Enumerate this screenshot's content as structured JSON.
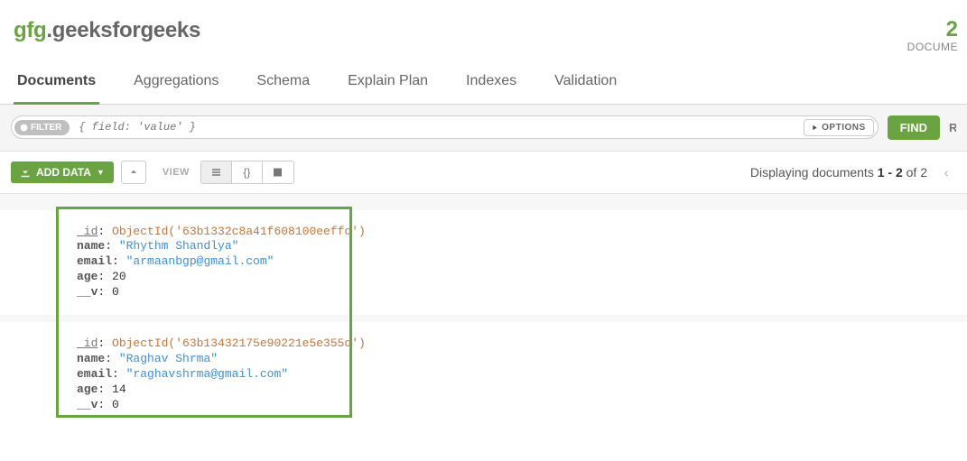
{
  "namespace": {
    "db": "gfg",
    "dot": ".",
    "collection": "geeksforgeeks"
  },
  "stats": {
    "count": "2",
    "label": "DOCUME"
  },
  "tabs": [
    "Documents",
    "Aggregations",
    "Schema",
    "Explain Plan",
    "Indexes",
    "Validation"
  ],
  "activeTab": 0,
  "query": {
    "filterChip": "FILTER",
    "placeholder": "{ field: 'value' }",
    "optionsLabel": "OPTIONS",
    "findLabel": "FIND",
    "resetStub": "R"
  },
  "toolbar": {
    "addData": "ADD DATA",
    "viewLabel": "VIEW",
    "jsonViewGlyph": "{}"
  },
  "pager": {
    "prefix": "Displaying documents ",
    "range": "1 - 2",
    "ofWord": " of ",
    "total": "2"
  },
  "keys": {
    "id": "_id",
    "name": "name",
    "email": "email",
    "age": "age",
    "v": "__v"
  },
  "documents": [
    {
      "_id": "ObjectId('63b1332c8a41f608100eeffd')",
      "name": "\"Rhythm Shandlya\"",
      "email": "\"armaanbgp@gmail.com\"",
      "age": "20",
      "__v": "0"
    },
    {
      "_id": "ObjectId('63b13432175e90221e5e355d')",
      "name": "\"Raghav Shrma\"",
      "email": "\"raghavshrma@gmail.com\"",
      "age": "14",
      "__v": "0"
    }
  ]
}
